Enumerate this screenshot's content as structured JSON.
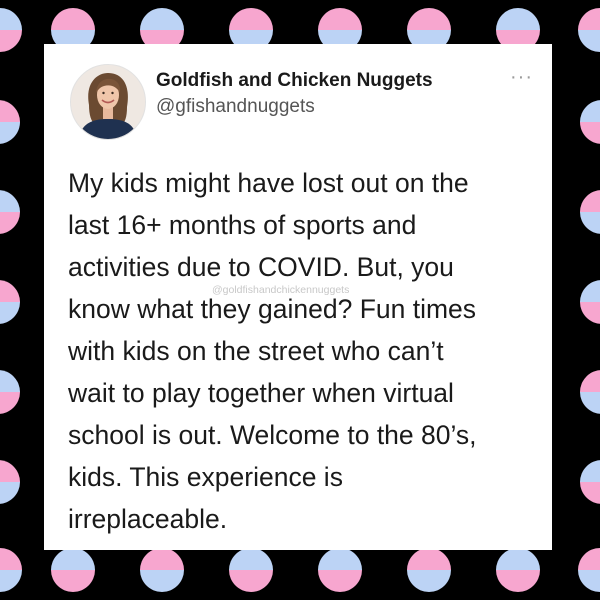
{
  "tweet": {
    "author_name": "Goldfish and Chicken Nuggets",
    "author_handle": "@gfishandnuggets",
    "more_icon": "more-dots-icon",
    "text": "My kids might have lost out on the\nlast 16+ months of sports and\nactivities due to COVID.  But, you\nknow what they gained?  Fun times\nwith kids on the street who can’t\nwait to play together when virtual\nschool is out.  Welcome to the 80’s,\nkids.  This experience is\nirreplaceable.",
    "watermark": "@goldfishandchickennuggets"
  },
  "theme": {
    "background": "#000000",
    "dot_pink": "#f7a6cf",
    "dot_blue": "#bcd3f5",
    "card": "#ffffff"
  }
}
